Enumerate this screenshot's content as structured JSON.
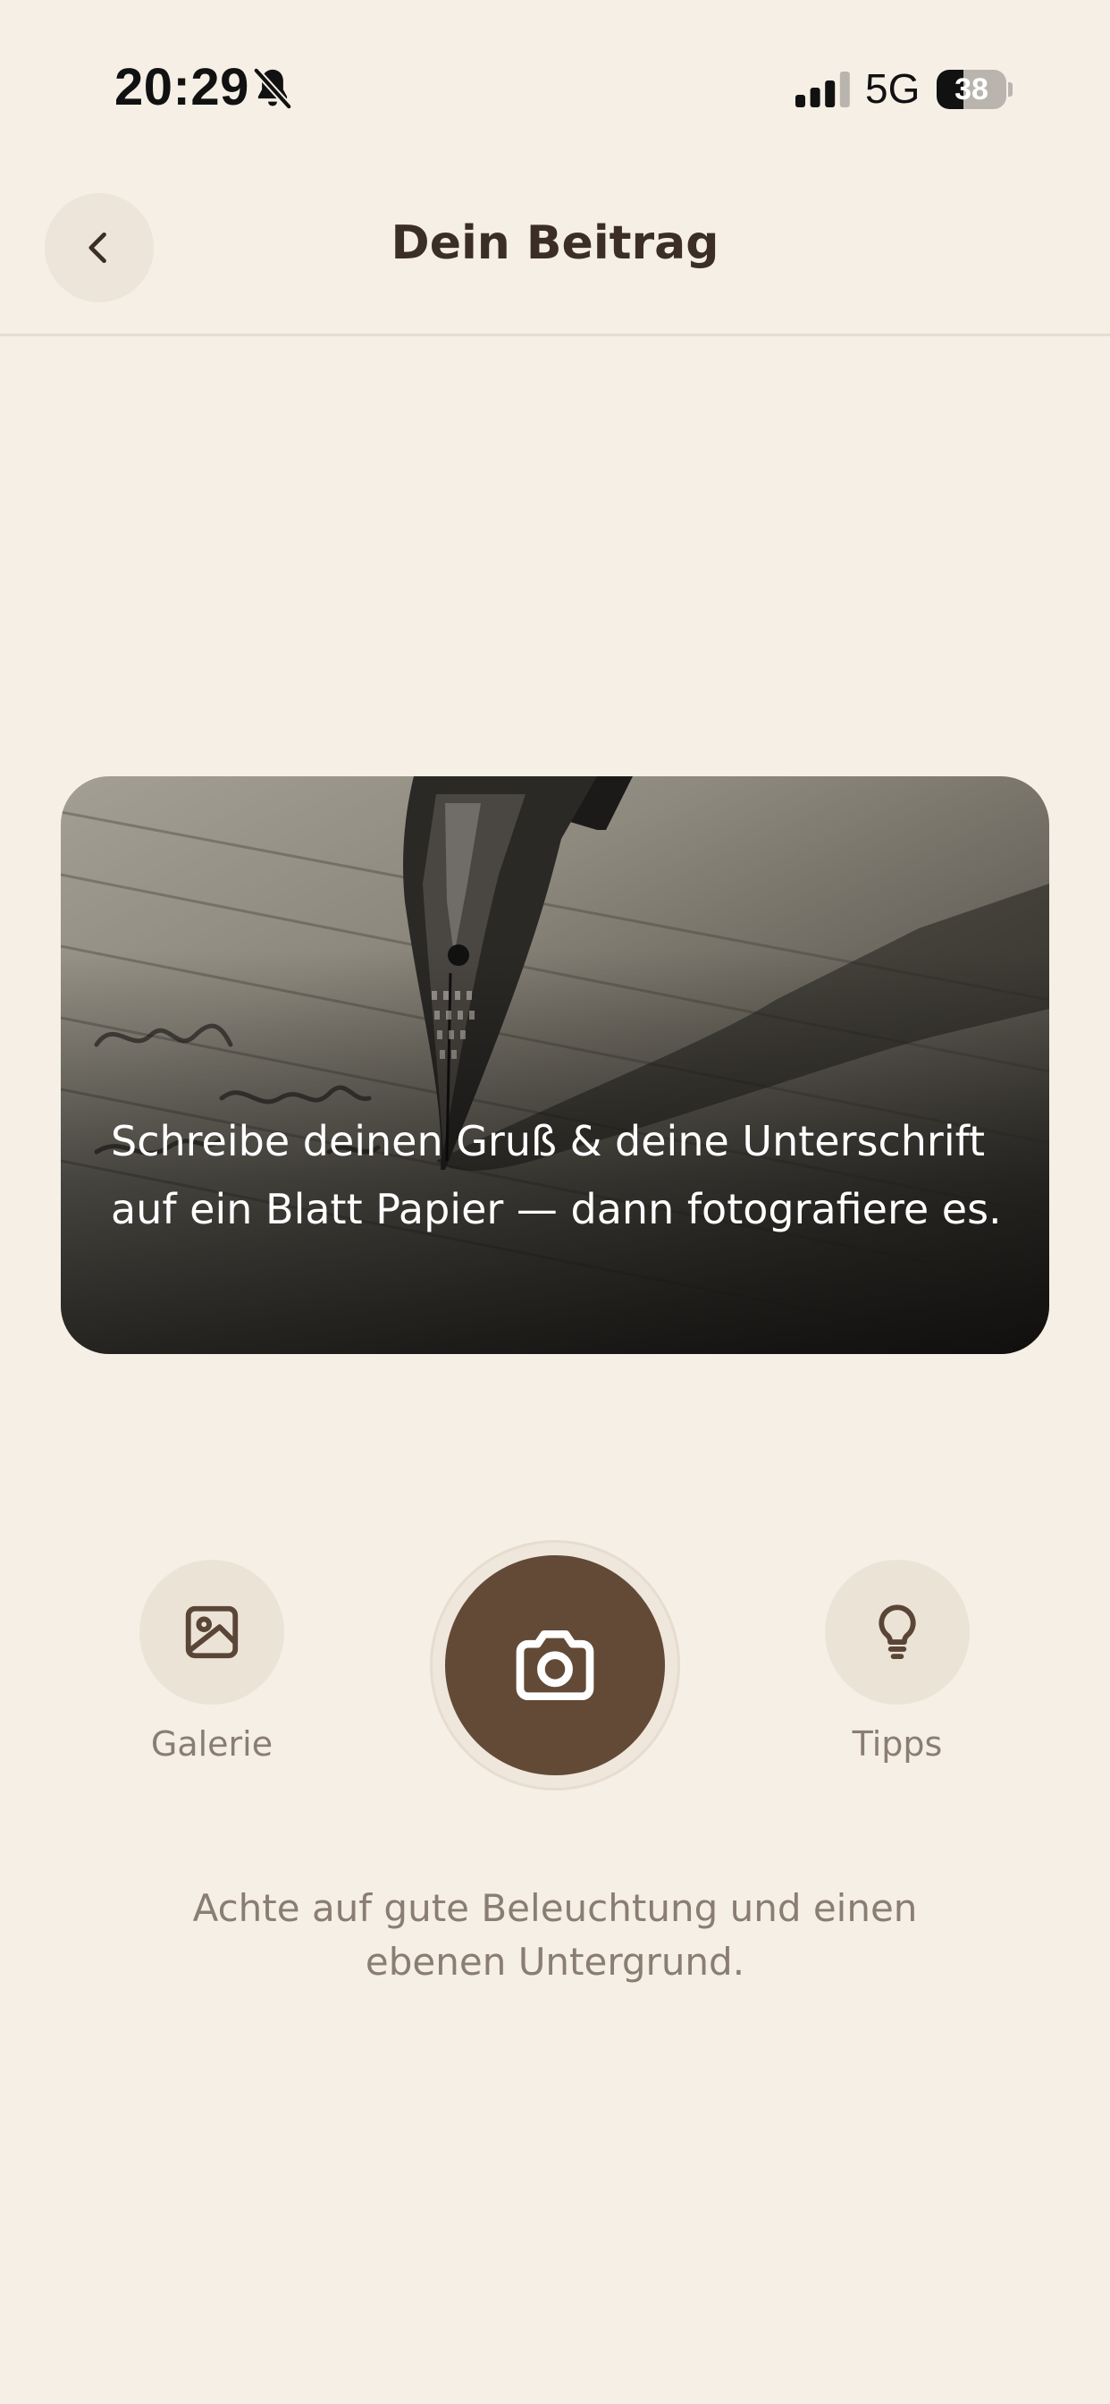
{
  "status_bar": {
    "time": "20:29",
    "network": "5G",
    "battery_percent": "38",
    "battery_level": 0.38,
    "icons": [
      "bell-off-icon",
      "signal-icon",
      "battery-icon"
    ]
  },
  "header": {
    "title": "Dein Beitrag",
    "back_icon": "chevron-left-icon"
  },
  "card": {
    "text": "Schreibe deinen Gruß & deine Unterschrift auf ein Blatt Papier — dann fotografiere es."
  },
  "actions": {
    "gallery_label": "Galerie",
    "gallery_icon": "image-icon",
    "shutter_icon": "camera-icon",
    "tips_label": "Tipps",
    "tips_icon": "lightbulb-icon"
  },
  "hint": "Achte auf gute Beleuchtung und einen ebenen Untergrund.",
  "colors": {
    "background": "#f5efe6",
    "accent": "#624a37",
    "text_primary": "#3b2e27",
    "text_muted": "#8a7d72"
  }
}
